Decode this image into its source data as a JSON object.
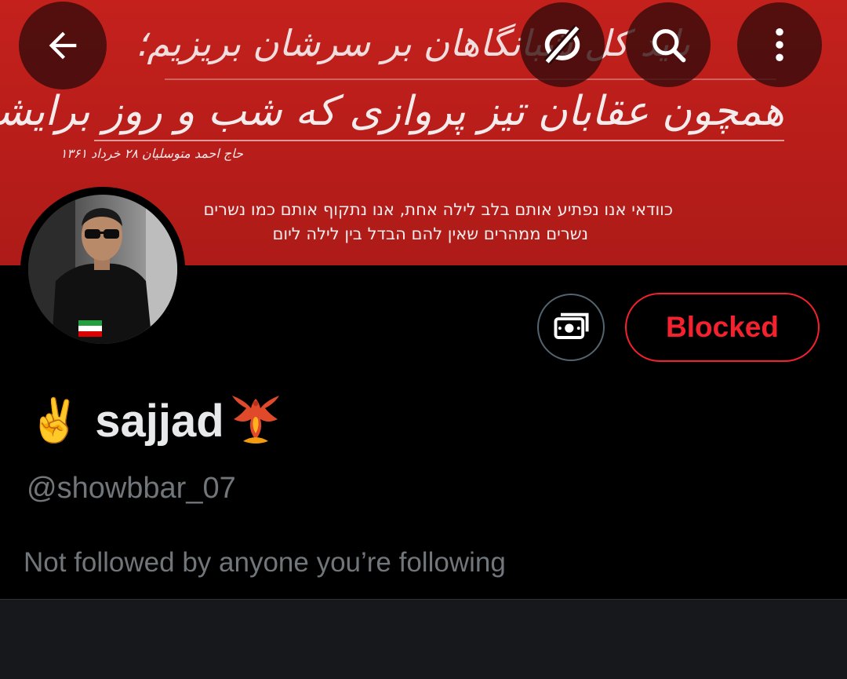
{
  "banner": {
    "persian_line_1": "باید کل شبانگاهان بر سرشان بریزیم؛",
    "persian_line_2": "همچون عقابان تیز پروازی که شب و روز برایشان معنا ندارد",
    "persian_credit": "حاج احمد متوسلیان ۲۸ خرداد ۱۳۶۱",
    "hebrew_line_1": "כוודאי אנו נפתיע אותם בלב לילה אחת, אנו נתקוף אותם כמו נשרים",
    "hebrew_line_2": "נשרים ממהרים שאין להם הבדל בין לילה ליום"
  },
  "toolbar": {
    "back_icon": "arrow-left-icon",
    "vpn_icon": "vpn-off-icon",
    "search_icon": "search-icon",
    "more_icon": "more-vertical-icon"
  },
  "profile": {
    "display_name": "sajjad",
    "name_prefix_emoji": "✌️",
    "name_suffix_icon": "phoenix-emoji",
    "handle": "@showbbar_07",
    "followers_note": "Not followed by anyone you’re following",
    "avatar_icon": "avatar"
  },
  "actions": {
    "tip_icon": "money-icon",
    "blocked_label": "Blocked"
  },
  "colors": {
    "banner_red": "#c4211c",
    "blocked_red": "#f4212e",
    "muted_text": "#71767b",
    "primary_text": "#e7e9ea",
    "background": "#000000"
  }
}
